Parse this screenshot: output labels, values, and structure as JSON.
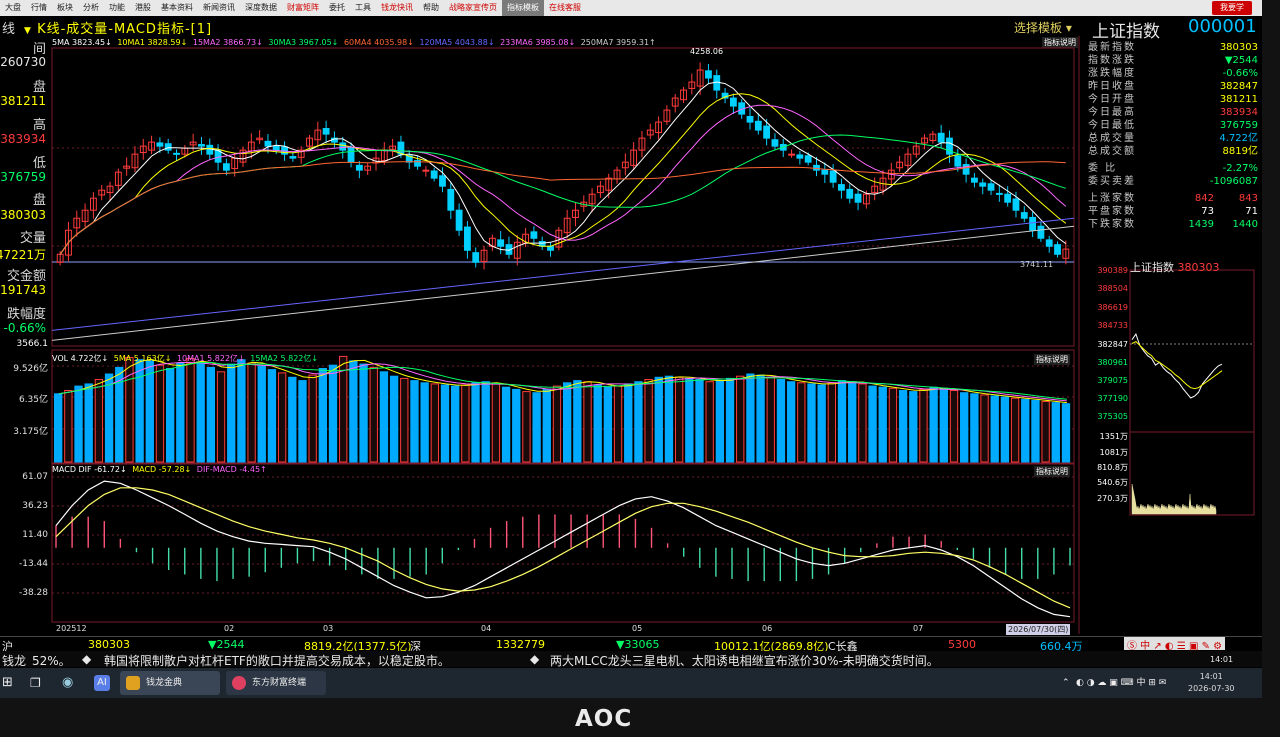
{
  "menu": {
    "items": [
      "大盘",
      "行情",
      "板块",
      "分析",
      "功能",
      "港股",
      "基本资料",
      "新闻资讯",
      "深度数据",
      "财富矩阵",
      "委托",
      "工具",
      "钱龙快讯",
      "帮助",
      "战略家宣传页",
      "指标模板",
      "在线客服"
    ],
    "right_label": "我要学"
  },
  "title": {
    "prefix": "线",
    "text": "K线-成交量-MACD指标-[1]",
    "select_label": "选择模板",
    "index_name": "上证指数",
    "index_code": "000001",
    "indicator_note": "指标说明"
  },
  "left_panel": [
    {
      "label": "间",
      "value": "260730",
      "color": "#e8e8e8"
    },
    {
      "label": "盘",
      "value": "381211",
      "color": "#ffff00"
    },
    {
      "label": "高",
      "value": "383934",
      "color": "#ff3b3b"
    },
    {
      "label": "低",
      "value": "376759",
      "color": "#00ff66"
    },
    {
      "label": "盘",
      "value": "380303",
      "color": "#ffff00"
    },
    {
      "label": "交量",
      "value": "47221万",
      "color": "#ffff00"
    },
    {
      "label": "交金额",
      "value": "8191743",
      "color": "#ffff00"
    },
    {
      "label": "跌幅度",
      "value": "-0.66%",
      "color": "#00ff66"
    }
  ],
  "ma_legend": [
    {
      "text": "5MA 3823.45↓",
      "color": "#ffffff"
    },
    {
      "text": "10MA1 3828.59↓",
      "color": "#ffff00"
    },
    {
      "text": "15MA2 3866.73↓",
      "color": "#ff66ff"
    },
    {
      "text": "30MA3 3967.05↓",
      "color": "#00ff66"
    },
    {
      "text": "60MA4 4035.98↓",
      "color": "#ff6633"
    },
    {
      "text": "120MA5 4043.88↓",
      "color": "#6666ff"
    },
    {
      "text": "233MA6 3985.08↓",
      "color": "#ff66ff"
    },
    {
      "text": "250MA7 3959.31↑",
      "color": "#cccccc"
    }
  ],
  "chart_data": [
    {
      "type": "candlestick",
      "title": "K线",
      "annotations": {
        "high": "4258.06",
        "low": "3741.11"
      },
      "y_axis_min": "3566.1",
      "closes": [
        3790,
        3850,
        3880,
        3900,
        3930,
        3950,
        3960,
        3995,
        4010,
        4040,
        4060,
        4070,
        4060,
        4050,
        4040,
        4055,
        4070,
        4060,
        4040,
        4020,
        4000,
        4030,
        4050,
        4070,
        4080,
        4060,
        4050,
        4040,
        4030,
        4050,
        4080,
        4100,
        4090,
        4070,
        4050,
        4020,
        4000,
        4010,
        4030,
        4050,
        4060,
        4040,
        4020,
        4010,
        4000,
        3980,
        3960,
        3900,
        3850,
        3800,
        3770,
        3800,
        3830,
        3810,
        3790,
        3820,
        3840,
        3830,
        3810,
        3800,
        3850,
        3880,
        3900,
        3920,
        3940,
        3960,
        3980,
        4000,
        4020,
        4050,
        4080,
        4100,
        4120,
        4150,
        4180,
        4200,
        4220,
        4250,
        4230,
        4200,
        4180,
        4160,
        4140,
        4120,
        4100,
        4080,
        4060,
        4050,
        4040,
        4030,
        4020,
        4000,
        3990,
        3970,
        3950,
        3930,
        3920,
        3940,
        3960,
        3980,
        4000,
        4020,
        4040,
        4060,
        4080,
        4090,
        4070,
        4040,
        4010,
        3990,
        3970,
        3960,
        3950,
        3940,
        3920,
        3900,
        3880,
        3850,
        3830,
        3810,
        3790,
        3803
      ]
    },
    {
      "type": "bar",
      "title": "VOL",
      "y_ticks": [
        "9.526亿",
        "6.35亿",
        "3.175亿"
      ],
      "values": [
        6.2,
        6.5,
        6.9,
        7.1,
        7.5,
        8.0,
        8.6,
        9.5,
        9.3,
        9.2,
        8.8,
        8.5,
        9.0,
        9.4,
        9.1,
        8.6,
        8.2,
        8.9,
        9.3,
        9.0,
        8.7,
        8.4,
        8.1,
        7.7,
        7.4,
        7.9,
        8.5,
        8.8,
        9.6,
        9.2,
        8.9,
        8.6,
        8.2,
        7.8,
        7.6,
        7.4,
        7.2,
        7.1,
        7.0,
        6.9,
        7.0,
        7.2,
        7.3,
        7.1,
        6.8,
        6.6,
        6.4,
        6.3,
        6.6,
        6.9,
        7.2,
        7.4,
        7.3,
        7.0,
        6.8,
        6.9,
        7.1,
        7.3,
        7.5,
        7.7,
        7.8,
        7.7,
        7.6,
        7.5,
        7.3,
        7.4,
        7.6,
        7.8,
        8.0,
        7.9,
        7.7,
        7.5,
        7.3,
        7.2,
        7.1,
        7.0,
        7.2,
        7.4,
        7.3,
        7.1,
        6.9,
        6.8,
        6.7,
        6.5,
        6.4,
        6.6,
        6.8,
        6.7,
        6.5,
        6.3,
        6.2,
        6.1,
        6.0,
        5.9,
        5.8,
        5.7,
        5.6,
        5.5,
        5.4,
        5.3
      ]
    },
    {
      "type": "line",
      "title": "MACD",
      "y_ticks": [
        "61.07",
        "36.23",
        "11.40",
        "-13.44",
        "-38.28"
      ],
      "x_ticks": [
        "202512",
        "02",
        "03",
        "04",
        "05",
        "06",
        "07"
      ],
      "series": [
        {
          "name": "DIF",
          "values": [
            20,
            38,
            52,
            60,
            58,
            52,
            45,
            38,
            30,
            22,
            15,
            10,
            6,
            4,
            3,
            2,
            1,
            -4,
            -10,
            -18,
            -26,
            -34,
            -40,
            -45,
            -44,
            -40,
            -34,
            -26,
            -18,
            -10,
            -2,
            6,
            14,
            22,
            30,
            38,
            44,
            46,
            42,
            36,
            28,
            20,
            14,
            8,
            2,
            -4,
            -10,
            -14,
            -16,
            -14,
            -10,
            -6,
            -2,
            0,
            2,
            -2,
            -8,
            -16,
            -26,
            -36,
            -46,
            -54,
            -60,
            -62
          ]
        },
        {
          "name": "MACD",
          "values": [
            10,
            24,
            38,
            48,
            54,
            54,
            52,
            48,
            42,
            36,
            30,
            24,
            19,
            15,
            12,
            9,
            7,
            4,
            0,
            -6,
            -12,
            -20,
            -27,
            -33,
            -37,
            -39,
            -38,
            -35,
            -30,
            -24,
            -17,
            -9,
            -1,
            7,
            15,
            23,
            31,
            37,
            40,
            40,
            37,
            33,
            28,
            23,
            17,
            11,
            5,
            0,
            -4,
            -7,
            -8,
            -8,
            -7,
            -5,
            -4,
            -5,
            -7,
            -11,
            -17,
            -24,
            -32,
            -40,
            -48,
            -54
          ]
        }
      ],
      "legend": [
        "DIF -61.72↓",
        "MACD -57.28↓",
        "DIF-MACD -4.45↑"
      ]
    }
  ],
  "vol_legend": [
    {
      "text": "VOL 4.722亿↓",
      "color": "#ffffff"
    },
    {
      "text": "5MA 5.163亿↓",
      "color": "#ffff00"
    },
    {
      "text": "10MA1 5.822亿↓",
      "color": "#ff66ff"
    },
    {
      "text": "15MA2 5.822亿↓",
      "color": "#00ff66"
    }
  ],
  "macd_legend": [
    {
      "text": "MACD DIF -61.72↓",
      "color": "#ffffff"
    },
    {
      "text": "MACD -57.28↓",
      "color": "#ffff00"
    },
    {
      "text": "DIF-MACD -4.45↑",
      "color": "#ff66ff"
    }
  ],
  "date_label": "2026/07/30(四)",
  "quote_panel": [
    {
      "k": "最新指数",
      "v": "380303",
      "c": "#ffff00"
    },
    {
      "k": "指数涨跌",
      "v": "▼2544",
      "c": "#00ff66"
    },
    {
      "k": "涨跌幅度",
      "v": "-0.66%",
      "c": "#00ff66"
    },
    {
      "k": "昨日收盘",
      "v": "382847",
      "c": "#ffff00"
    },
    {
      "k": "今日开盘",
      "v": "381211",
      "c": "#ffff00"
    },
    {
      "k": "今日最高",
      "v": "383934",
      "c": "#ff3b3b"
    },
    {
      "k": "今日最低",
      "v": "376759",
      "c": "#00ff66"
    },
    {
      "k": "总成交量",
      "v": "4.722亿",
      "c": "#00c0ff"
    },
    {
      "k": "总成交额",
      "v": "8819亿",
      "c": "#ffff00"
    },
    {
      "k": "委  比",
      "v": "-2.27%",
      "c": "#00ff66"
    },
    {
      "k": "委买卖差",
      "v": "-1096087",
      "c": "#00ff66"
    },
    {
      "k": "上涨家数",
      "v": "842",
      "v2": "843",
      "c": "#ff3b3b"
    },
    {
      "k": "平盘家数",
      "v": "73",
      "v2": "71",
      "c": "#ffffff"
    },
    {
      "k": "下跌家数",
      "v": "1439",
      "v2": "1440",
      "c": "#00ff66"
    }
  ],
  "mini_chart": {
    "title": "上证指数",
    "value": "380303",
    "y_ticks": [
      {
        "t": "390389",
        "c": "#ff3b3b"
      },
      {
        "t": "388504",
        "c": "#ff3b3b"
      },
      {
        "t": "386619",
        "c": "#ff3b3b"
      },
      {
        "t": "384733",
        "c": "#ff3b3b"
      },
      {
        "t": "382847",
        "c": "#ffffff"
      },
      {
        "t": "380961",
        "c": "#00ff66"
      },
      {
        "t": "379075",
        "c": "#00ff66"
      },
      {
        "t": "377190",
        "c": "#00ff66"
      },
      {
        "t": "375305",
        "c": "#00ff66"
      }
    ],
    "vol_ticks": [
      "1351万",
      "1081万",
      "810.8万",
      "540.6万",
      "270.3万"
    ],
    "price_line": [
      3832,
      3838,
      3826,
      3820,
      3815,
      3812,
      3805,
      3808,
      3802,
      3798,
      3795,
      3790,
      3786,
      3780,
      3775,
      3770,
      3772,
      3776,
      3785,
      3790,
      3795,
      3800,
      3804,
      3806
    ],
    "avg_line": [
      3828,
      3830,
      3826,
      3822,
      3818,
      3815,
      3810,
      3808,
      3805,
      3802,
      3799,
      3795,
      3792,
      3788,
      3784,
      3781,
      3780,
      3781,
      3784,
      3787,
      3790,
      3793,
      3796,
      3799
    ]
  },
  "bottom_bar": {
    "left": "沪",
    "sh_value": "380303",
    "sh_change": "▼2544",
    "sh_amount": "8819.2亿(1377.5亿)",
    "sz_label": "深",
    "sz_value": "1332779",
    "sz_change": "▼33065",
    "sz_amount": "10012.1亿(2869.8亿)",
    "cy_label": "C长鑫",
    "cy_change": "5300",
    "cy_amount": "660.4万"
  },
  "news": {
    "prefix": "钱龙",
    "pct": "52%。",
    "item1": "韩国将限制散户对杠杆ETF的敞口并提高交易成本，以稳定股市。",
    "item2": "两大MLCC龙头三星电机、太阳诱电相继宣布涨价30%-未明确交货时间。"
  },
  "taskbar": {
    "app1": "钱龙金典",
    "app2": "东方财富终端",
    "time": "14:01",
    "date": "2026-07-30",
    "tray_lang": "中"
  },
  "brand": "AOC"
}
